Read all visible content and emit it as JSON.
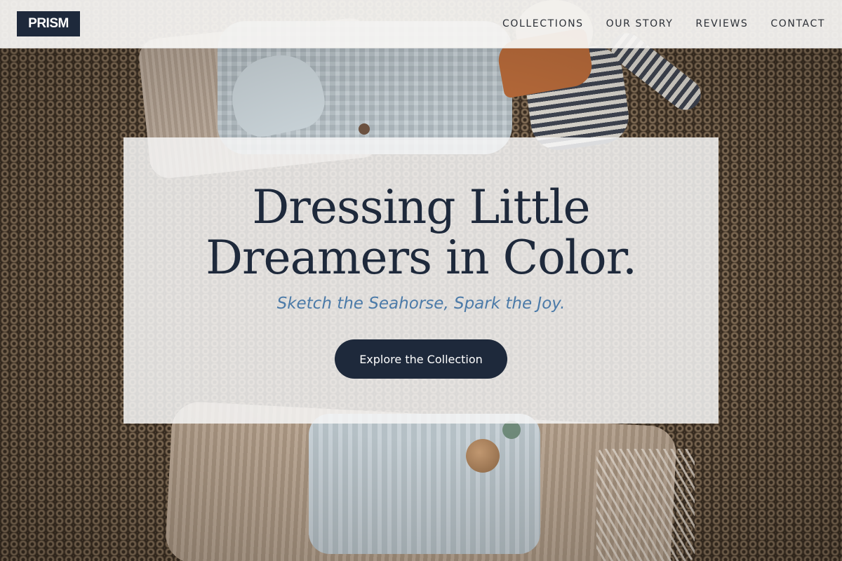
{
  "brand": {
    "logo_text": "PRISM",
    "primary_color": "#1e293b",
    "accent_color": "#4b7aa8"
  },
  "nav": {
    "items": [
      {
        "label": "COLLECTIONS"
      },
      {
        "label": "OUR STORY"
      },
      {
        "label": "REVIEWS"
      },
      {
        "label": "CONTACT"
      }
    ]
  },
  "hero": {
    "title_line_1": "Dressing Little",
    "title_line_2": "Dreamers in Color.",
    "tagline": "Sketch the Seahorse, Spark the Joy.",
    "cta_label": "Explore the Collection"
  }
}
